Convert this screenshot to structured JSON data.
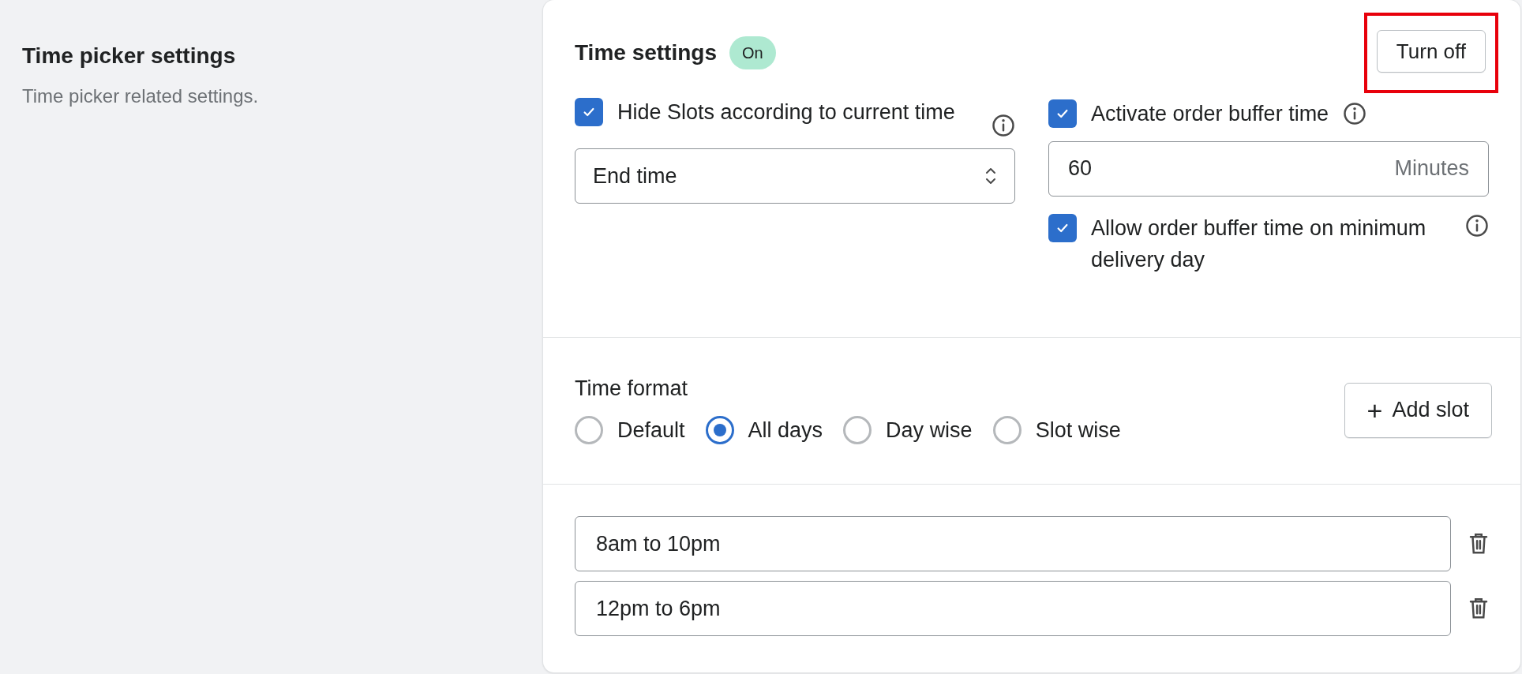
{
  "intro": {
    "title": "Time picker settings",
    "description": "Time picker related settings."
  },
  "header": {
    "title": "Time settings",
    "badge": {
      "label": "On",
      "on": true
    },
    "button": {
      "label": "Turn off",
      "highlighted": true
    }
  },
  "hide_slots": {
    "label": "Hide Slots according to current time",
    "checked": true,
    "select": {
      "value": "End time"
    }
  },
  "buffer": {
    "label": "Activate order buffer time",
    "checked": true,
    "input": {
      "value": "60",
      "suffix": "Minutes"
    }
  },
  "allow_buffer": {
    "label": "Allow order buffer time on minimum delivery day",
    "checked": true
  },
  "time_format": {
    "label": "Time format",
    "options": [
      {
        "label": "Default",
        "selected": false
      },
      {
        "label": "All days",
        "selected": true
      },
      {
        "label": "Day wise",
        "selected": false
      },
      {
        "label": "Slot wise",
        "selected": false
      }
    ]
  },
  "add_slot": {
    "icon": "+",
    "label": "Add slot"
  },
  "slots": [
    {
      "value": "8am to 10pm"
    },
    {
      "value": "12pm to 6pm"
    }
  ]
}
